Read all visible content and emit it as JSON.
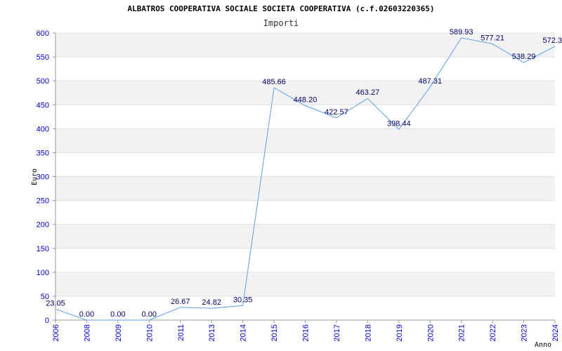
{
  "chart_data": {
    "type": "line",
    "title": "ALBATROS COOPERATIVA SOCIALE SOCIETA COOPERATIVA (c.f.02603220365)",
    "subtitle": "Importi",
    "xlabel": "Anno",
    "ylabel": "Euro",
    "ylim": [
      0,
      600
    ],
    "yticks": [
      0,
      50,
      100,
      150,
      200,
      250,
      300,
      350,
      400,
      450,
      500,
      550,
      600
    ],
    "grid": true,
    "legend": "none",
    "categories": [
      "2006",
      "2008",
      "2009",
      "2010",
      "2011",
      "2013",
      "2014",
      "2015",
      "2016",
      "2017",
      "2018",
      "2019",
      "2020",
      "2021",
      "2022",
      "2023",
      "2024"
    ],
    "values": [
      23.05,
      0.0,
      0.0,
      0.0,
      26.67,
      24.82,
      30.35,
      485.66,
      448.2,
      422.57,
      463.27,
      398.44,
      487.31,
      589.93,
      577.21,
      538.29,
      572.3
    ],
    "data_labels": [
      "23.05",
      "0.00",
      "0.00",
      "0.00",
      "26.67",
      "24.82",
      "30.35",
      "485.66",
      "448.20",
      "422.57",
      "463.27",
      "398.44",
      "487.31",
      "589.93",
      "577.21",
      "538.29",
      "572.3"
    ],
    "colors": {
      "line": "#5aa0e8",
      "band": "#f2f2f2",
      "tick_text": "#0000cc",
      "label_text": "#000066"
    }
  }
}
